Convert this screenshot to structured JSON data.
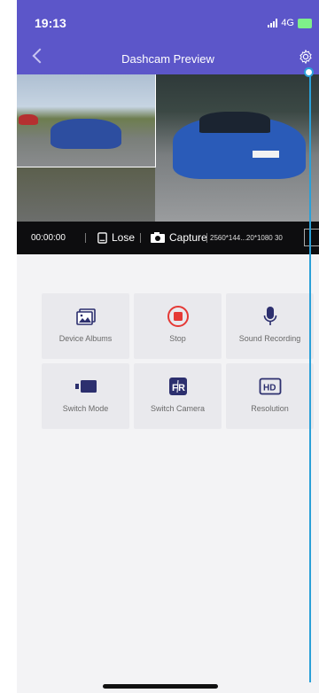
{
  "status_bar": {
    "time": "19:13",
    "network": "4G"
  },
  "nav": {
    "title": "Dashcam Preview"
  },
  "control_bar": {
    "elapsed": "00:00:00",
    "lose_label": "Lose",
    "capture_label": "Capture",
    "resolution": "2560*144...20*1080 30"
  },
  "actions": [
    {
      "label": "Device Albums",
      "icon": "albums-icon"
    },
    {
      "label": "Stop",
      "icon": "stop-record-icon"
    },
    {
      "label": "Sound Recording",
      "icon": "microphone-icon"
    },
    {
      "label": "Switch Mode",
      "icon": "video-camera-icon"
    },
    {
      "label": "Switch Camera",
      "icon": "front-rear-icon"
    },
    {
      "label": "Resolution",
      "icon": "hd-icon"
    }
  ],
  "colors": {
    "brand": "#5c56c9",
    "record_red": "#e53935",
    "icon_navy": "#2c2f6e"
  }
}
